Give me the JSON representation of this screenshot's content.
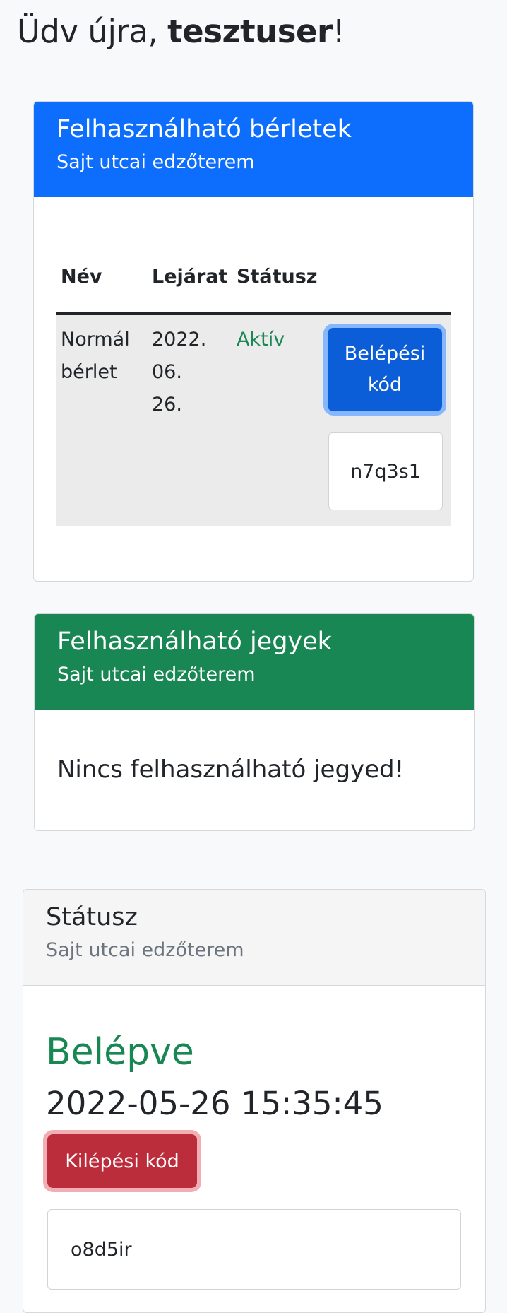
{
  "welcome": {
    "prefix": "Üdv újra, ",
    "username": "tesztuser",
    "suffix": "!"
  },
  "passes_card": {
    "title": "Felhasználható bérletek",
    "subtitle": "Sajt utcai edzőterem",
    "columns": [
      "Név",
      "Lejárat",
      "Státusz"
    ],
    "rows": [
      {
        "name": "Normál bérlet",
        "expiry": "2022. 06. 26.",
        "status": "Aktív",
        "button_label": "Belépési kód",
        "code": "n7q3s1"
      }
    ]
  },
  "tickets_card": {
    "title": "Felhasználható jegyek",
    "subtitle": "Sajt utcai edzőterem",
    "empty_message": "Nincs felhasználható jegyed!"
  },
  "status_card": {
    "title": "Státusz",
    "subtitle": "Sajt utcai edzőterem",
    "state": "Belépve",
    "timestamp": "2022-05-26 15:35:45",
    "button_label": "Kilépési kód",
    "code": "o8d5ir"
  },
  "colors": {
    "primary": "#0d6efd",
    "success": "#198754",
    "danger": "#bb2d3b"
  }
}
